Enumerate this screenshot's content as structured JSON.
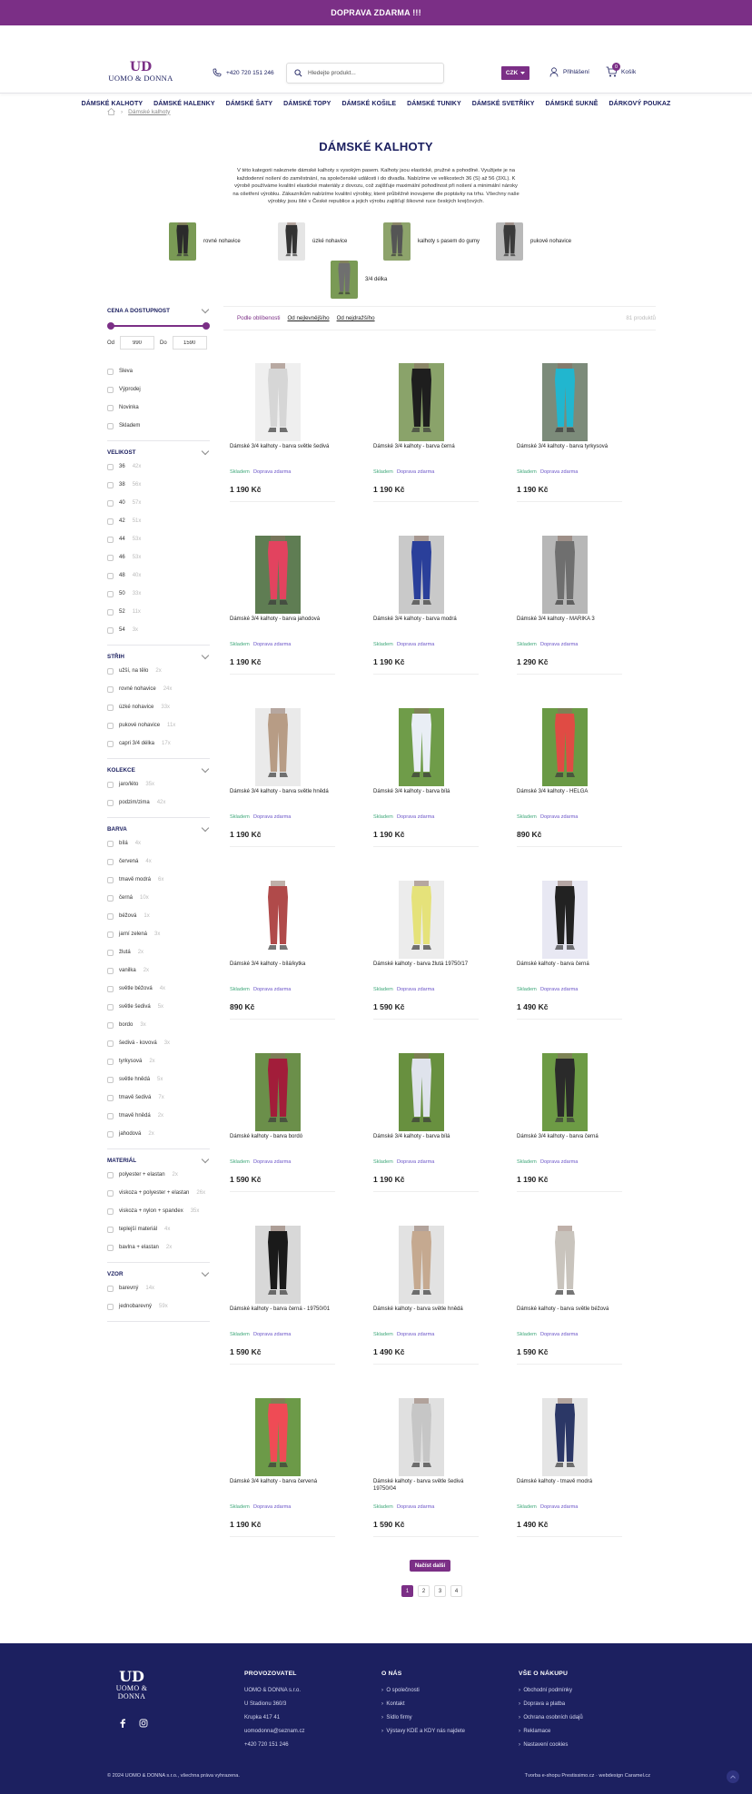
{
  "topbar": {
    "text": "DOPRAVA ZDARMA !!!"
  },
  "header": {
    "logo_mark": "UD",
    "logo_text": "UOMO & DONNA",
    "phone": "+420 720 151 246",
    "search_placeholder": "Hledejte produkt...",
    "currency": "CZK",
    "login": "Přihlášení",
    "cart": "Košík",
    "cart_count": "0"
  },
  "nav": [
    "DÁMSKÉ KALHOTY",
    "DÁMSKÉ HALENKY",
    "DÁMSKÉ ŠATY",
    "DÁMSKÉ TOPY",
    "DÁMSKÉ KOŠILE",
    "DÁMSKÉ TUNIKY",
    "DÁMSKÉ SVETŘÍKY",
    "DÁMSKÉ SUKNĚ",
    "DÁRKOVÝ POUKAZ"
  ],
  "breadcrumb": {
    "current": "Dámské kalhoty"
  },
  "page": {
    "title": "DÁMSKÉ KALHOTY",
    "description": "V této kategorii naleznete dámské kalhoty s vysokým pasem. Kalhoty jsou elastické, pružné a pohodlné. Využijete je na každodenní nošení do zaměstnání, na společenské události i do divadla. Nabízíme ve velikostech 36 (S) až 56 (3XL). K výrobě používáme kvalitní elastické materiály z dovozu, což zajišťuje maximální pohodlnost při nošení a minimální nároky na ošetření výrobku. Zákazníkům nabízíme kvalitní výrobky, které průběžně inovujeme dle poptávky na trhu. Všechny naše výrobky jsou šité v České republice a jejich výrobu zajišťují šikovné ruce českých krejčových."
  },
  "subcategories": [
    "rovné nohavice",
    "úzké nohavice",
    "kalhoty s pasem do gumy",
    "pukové nohavice",
    "3/4 délka"
  ],
  "filters": {
    "price": {
      "title": "CENA A DOSTUPNOST",
      "from_label": "Od",
      "to_label": "Do",
      "min": "990",
      "max": "1590"
    },
    "availability": [
      "Sleva",
      "Výprodej",
      "Novinka",
      "Skladem"
    ],
    "groups": [
      {
        "title": "VELIKOST",
        "items": [
          [
            "36",
            "42x"
          ],
          [
            "38",
            "56x"
          ],
          [
            "40",
            "57x"
          ],
          [
            "42",
            "51x"
          ],
          [
            "44",
            "53x"
          ],
          [
            "46",
            "53x"
          ],
          [
            "48",
            "40x"
          ],
          [
            "50",
            "33x"
          ],
          [
            "52",
            "11x"
          ],
          [
            "54",
            "3x"
          ]
        ]
      },
      {
        "title": "STŘIH",
        "items": [
          [
            "užší, na tělo",
            "2x"
          ],
          [
            "rovné nohavice",
            "24x"
          ],
          [
            "úzké nohavice",
            "33x"
          ],
          [
            "pukové nohavice",
            "11x"
          ],
          [
            "capri 3/4 délka",
            "17x"
          ]
        ]
      },
      {
        "title": "KOLEKCE",
        "items": [
          [
            "jaro/léto",
            "35x"
          ],
          [
            "podzim/zima",
            "42x"
          ]
        ]
      },
      {
        "title": "BARVA",
        "items": [
          [
            "bílá",
            "4x"
          ],
          [
            "červená",
            "4x"
          ],
          [
            "tmavě modrá",
            "6x"
          ],
          [
            "černá",
            "10x"
          ],
          [
            "béžová",
            "1x"
          ],
          [
            "jarní zelená",
            "3x"
          ],
          [
            "žlutá",
            "2x"
          ],
          [
            "vanilka",
            "2x"
          ],
          [
            "světle béžová",
            "4x"
          ],
          [
            "světle šedivá",
            "5x"
          ],
          [
            "bordo",
            "3x"
          ],
          [
            "šedivá - kovová",
            "3x"
          ],
          [
            "tyrkysová",
            "2x"
          ],
          [
            "světle hnědá",
            "5x"
          ],
          [
            "tmavě šedivá",
            "7x"
          ],
          [
            "tmavě hnědá",
            "2x"
          ],
          [
            "jahodová",
            "2x"
          ]
        ]
      },
      {
        "title": "MATERIÁL",
        "items": [
          [
            "polyester + elastan",
            "2x"
          ],
          [
            "viskoza + polyester + elastan",
            "26x"
          ],
          [
            "viskoza + nylon + spandex",
            "35x"
          ],
          [
            "teplejší materiál",
            "4x"
          ],
          [
            "bavlna + elastan",
            "2x"
          ]
        ]
      },
      {
        "title": "VZOR",
        "items": [
          [
            "barevný",
            "14x"
          ],
          [
            "jednobarevný",
            "59x"
          ]
        ]
      }
    ]
  },
  "sort": {
    "label": "Podle oblíbenosti",
    "options": [
      "Od nejlevnějšího",
      "Od nejdražšího"
    ],
    "total": "81 produktů"
  },
  "product_labels": {
    "stock": "Skladem",
    "shipping": "Doprava zdarma"
  },
  "products": [
    {
      "name": "Dámské 3/4 kalhoty - barva světle šedivá",
      "price": "1 190 Kč",
      "color": "#d6d6d6",
      "bg": "#efefef"
    },
    {
      "name": "Dámské 3/4 kalhoty - barva černá",
      "price": "1 190 Kč",
      "color": "#1e1e1e",
      "bg": "#8aa36a"
    },
    {
      "name": "Dámské 3/4 kalhoty - barva tyrkysová",
      "price": "1 190 Kč",
      "color": "#21b6cf",
      "bg": "#7c8b7a"
    },
    {
      "name": "Dámské 3/4 kalhoty - barva jahodová",
      "price": "1 190 Kč",
      "color": "#e2435f",
      "bg": "#5f7d53"
    },
    {
      "name": "Dámské 3/4 kalhoty - barva modrá",
      "price": "1 190 Kč",
      "color": "#2a3f9a",
      "bg": "#c9c9c9"
    },
    {
      "name": "Dámské 3/4 kalhoty - MARIKA 3",
      "price": "1 290 Kč",
      "color": "#6f6f6f",
      "bg": "#b7b7b7"
    },
    {
      "name": "Dámské 3/4 kalhoty - barva světle hnědá",
      "price": "1 190 Kč",
      "color": "#b79c85",
      "bg": "#eaeaea"
    },
    {
      "name": "Dámské 3/4 kalhoty - barva bílá",
      "price": "1 190 Kč",
      "color": "#e9eef5",
      "bg": "#6f9c49"
    },
    {
      "name": "Dámské 3/4 kalhoty - HELGA",
      "price": "890 Kč",
      "color": "#e04b44",
      "bg": "#6a9a45"
    },
    {
      "name": "Dámské 3/4 kalhoty - bílá/kytka",
      "price": "890 Kč",
      "color": "#b04a4a",
      "bg": "#ffffff"
    },
    {
      "name": "Dámské kalhoty - barva žlutá 19750/17",
      "price": "1 590 Kč",
      "color": "#e5e27a",
      "bg": "#ececec"
    },
    {
      "name": "Dámské kalhoty - barva černá",
      "price": "1 490 Kč",
      "color": "#222222",
      "bg": "#e8e8f3"
    },
    {
      "name": "Dámské kalhoty - barva bordó",
      "price": "1 590 Kč",
      "color": "#a21d3a",
      "bg": "#6b8f4a"
    },
    {
      "name": "Dámské 3/4 kalhoty - barva bílá",
      "price": "1 190 Kč",
      "color": "#dfe3ec",
      "bg": "#68903f"
    },
    {
      "name": "Dámské 3/4 kalhoty - barva černá",
      "price": "1 190 Kč",
      "color": "#2a2a2a",
      "bg": "#6d9b45"
    },
    {
      "name": "Dámské kalhoty - barva černá - 19750/01",
      "price": "1 590 Kč",
      "color": "#1a1a1a",
      "bg": "#d8d8d8"
    },
    {
      "name": "Dámské kalhoty - barva světle hnědá",
      "price": "1 490 Kč",
      "color": "#c5a990",
      "bg": "#e2e2e2"
    },
    {
      "name": "Dámské kalhoty - barva světle béžová",
      "price": "1 590 Kč",
      "color": "#c9c4bd",
      "bg": "#ffffff"
    },
    {
      "name": "Dámské 3/4 kalhoty - barva červená",
      "price": "1 190 Kč",
      "color": "#ef4b55",
      "bg": "#6c9a48"
    },
    {
      "name": "Dámské kalhoty - barva světle šedivá 19750/04",
      "price": "1 590 Kč",
      "color": "#c6c6c6",
      "bg": "#e0e0e0"
    },
    {
      "name": "Dámské kalhoty - tmavě modrá",
      "price": "1 490 Kč",
      "color": "#2b3766",
      "bg": "#e5e5e5"
    }
  ],
  "load_more": "Načíst další",
  "pagination": [
    "1",
    "2",
    "3",
    "4"
  ],
  "footer": {
    "logo_mark": "UD",
    "logo_text": "UOMO & DONNA",
    "col1": {
      "title": "PROVOZOVATEL",
      "rows": [
        "UOMO & DONNA s.r.o.",
        "U Stadionu 360/3",
        "Krupka 417 41",
        "uomodonna@seznam.cz",
        "+420 720 151 246"
      ]
    },
    "col2": {
      "title": "O NÁS",
      "rows": [
        "O společnosti",
        "Kontakt",
        "Sídlo firmy",
        "Výstavy KDE a KDY nás najdete"
      ]
    },
    "col3": {
      "title": "VŠE O NÁKUPU",
      "rows": [
        "Obchodní podmínky",
        "Doprava a platba",
        "Ochrana osobních údajů",
        "Reklamace",
        "Nastavení cookies"
      ]
    },
    "copyright": "© 2024 UOMO & DONNA s.r.o., všechna práva vyhrazena.",
    "credits": "Tvorba e-shopu Prestissimo.cz · webdesign Caramel.cz"
  },
  "colors": {
    "brand": "#7b2f86",
    "navy": "#1c2060",
    "stock": "#3fa87a",
    "shipping": "#6b55c8"
  }
}
